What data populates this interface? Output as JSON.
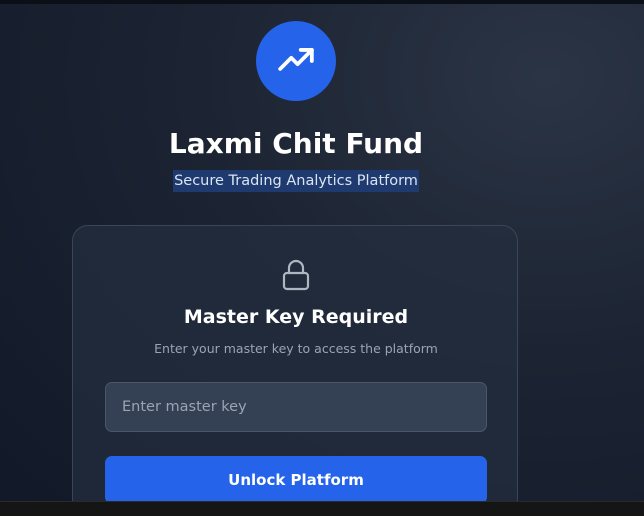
{
  "brand": {
    "title": "Laxmi Chit Fund",
    "subtitle": "Secure Trading Analytics Platform",
    "logo_icon": "trending-up-icon",
    "accent_color": "#2563eb"
  },
  "auth_card": {
    "icon": "lock-icon",
    "title": "Master Key Required",
    "description": "Enter your master key to access the platform",
    "key_input": {
      "value": "",
      "placeholder": "Enter master key"
    },
    "unlock_label": "Unlock Platform"
  }
}
